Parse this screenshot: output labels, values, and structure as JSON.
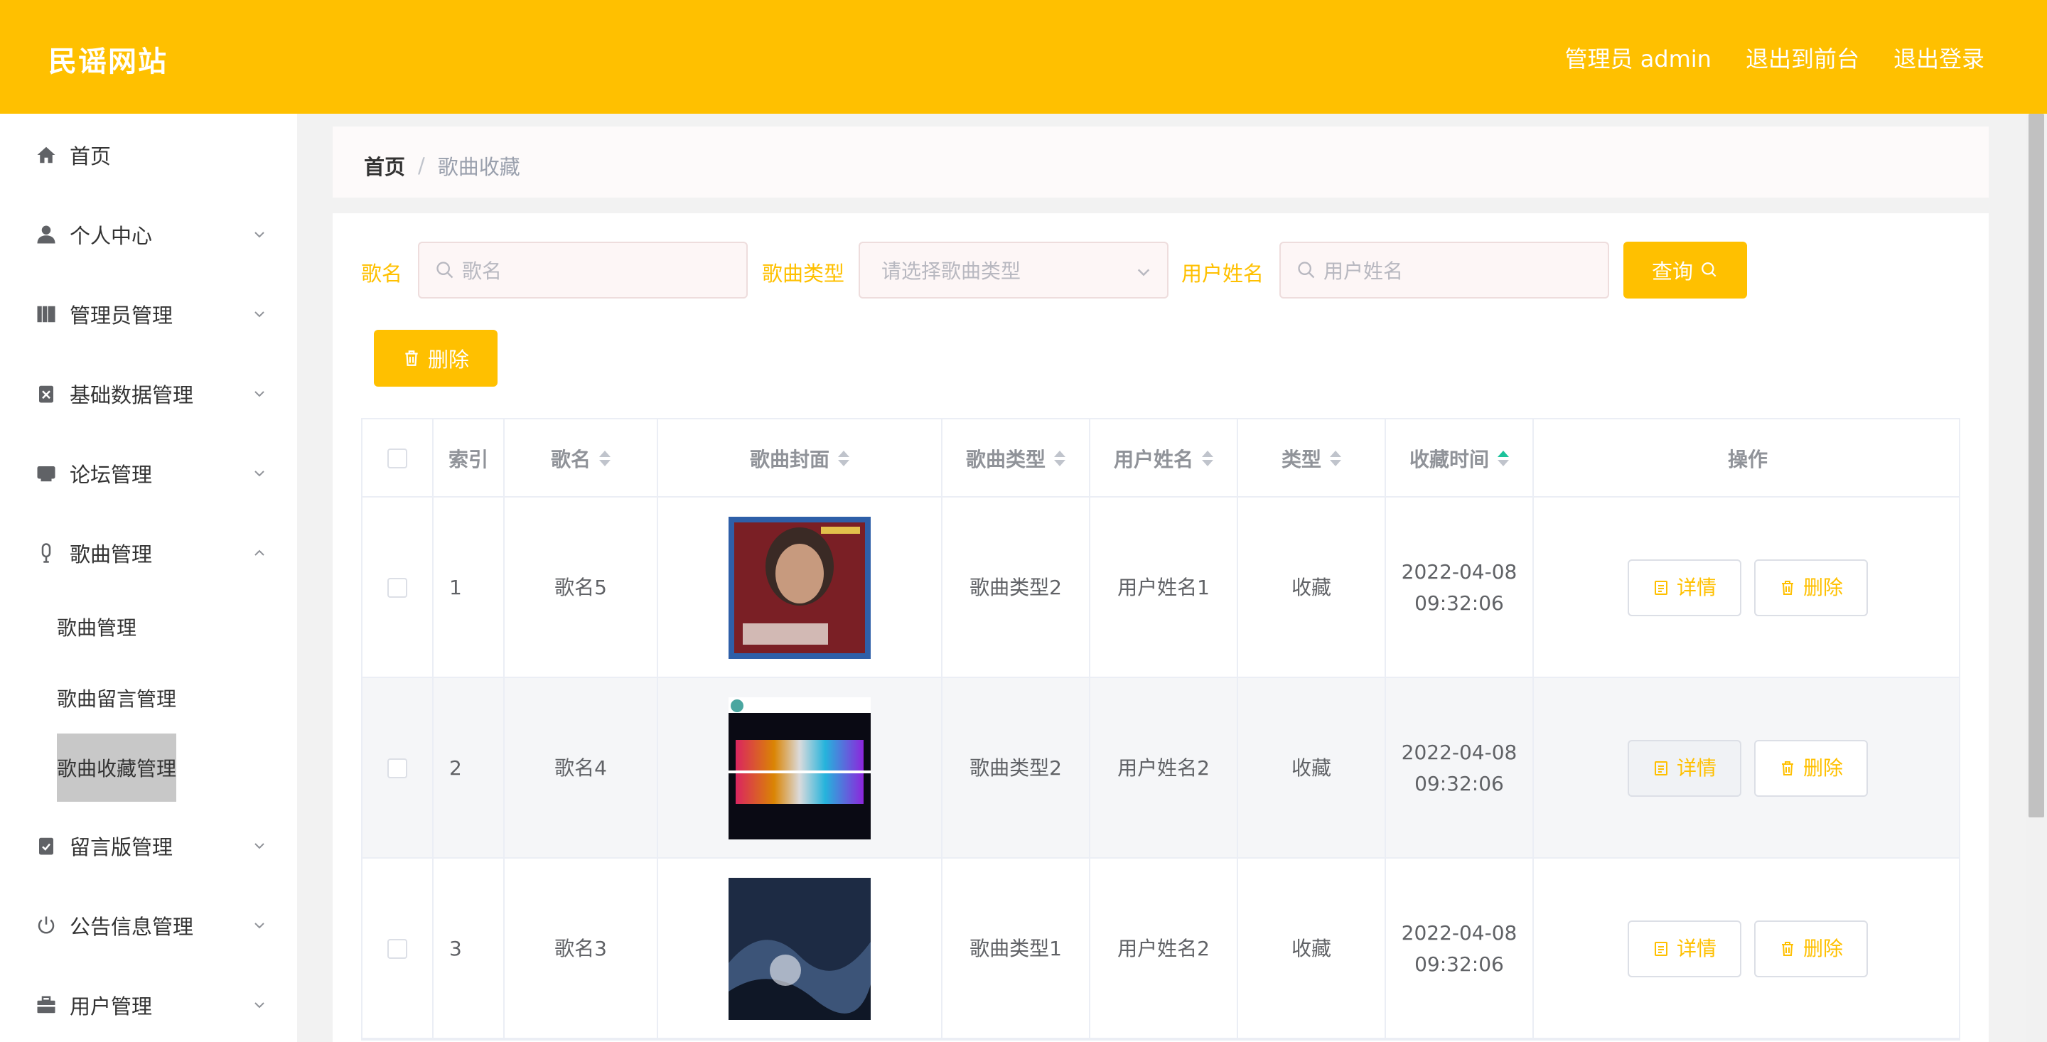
{
  "header": {
    "brand": "民谣网站",
    "admin_label": "管理员 admin",
    "exit_front": "退出到前台",
    "logout": "退出登录"
  },
  "sidebar": {
    "items": [
      {
        "label": "首页",
        "icon": "home-icon"
      },
      {
        "label": "个人中心",
        "icon": "user-icon"
      },
      {
        "label": "管理员管理",
        "icon": "book-icon"
      },
      {
        "label": "基础数据管理",
        "icon": "clipboard-x-icon"
      },
      {
        "label": "论坛管理",
        "icon": "inbox-icon"
      },
      {
        "label": "歌曲管理",
        "icon": "microphone-icon"
      },
      {
        "label": "留言版管理",
        "icon": "clipboard-check-icon"
      },
      {
        "label": "公告信息管理",
        "icon": "power-icon"
      },
      {
        "label": "用户管理",
        "icon": "briefcase-icon"
      }
    ],
    "sub_items": [
      "歌曲管理",
      "歌曲留言管理",
      "歌曲收藏管理"
    ]
  },
  "breadcrumb": {
    "home": "首页",
    "sep": "/",
    "current": "歌曲收藏"
  },
  "search": {
    "song_label": "歌名",
    "song_placeholder": "歌名",
    "type_label": "歌曲类型",
    "type_placeholder": "请选择歌曲类型",
    "user_label": "用户姓名",
    "user_placeholder": "用户姓名",
    "query_button": "查询"
  },
  "toolbar": {
    "delete_button": "删除"
  },
  "table": {
    "columns": [
      "索引",
      "歌名",
      "歌曲封面",
      "歌曲类型",
      "用户姓名",
      "类型",
      "收藏时间",
      "操作"
    ],
    "rows": [
      {
        "index": "1",
        "song": "歌名5",
        "song_type": "歌曲类型2",
        "user": "用户姓名1",
        "type": "收藏",
        "date": "2022-04-08",
        "time": "09:32:06"
      },
      {
        "index": "2",
        "song": "歌名4",
        "song_type": "歌曲类型2",
        "user": "用户姓名2",
        "type": "收藏",
        "date": "2022-04-08",
        "time": "09:32:06"
      },
      {
        "index": "3",
        "song": "歌名3",
        "song_type": "歌曲类型1",
        "user": "用户姓名2",
        "type": "收藏",
        "date": "2022-04-08",
        "time": "09:32:06"
      }
    ],
    "detail_label": "详情",
    "delete_label": "删除"
  },
  "colors": {
    "accent": "#FFC000",
    "sort_active": "#1cc39b"
  }
}
